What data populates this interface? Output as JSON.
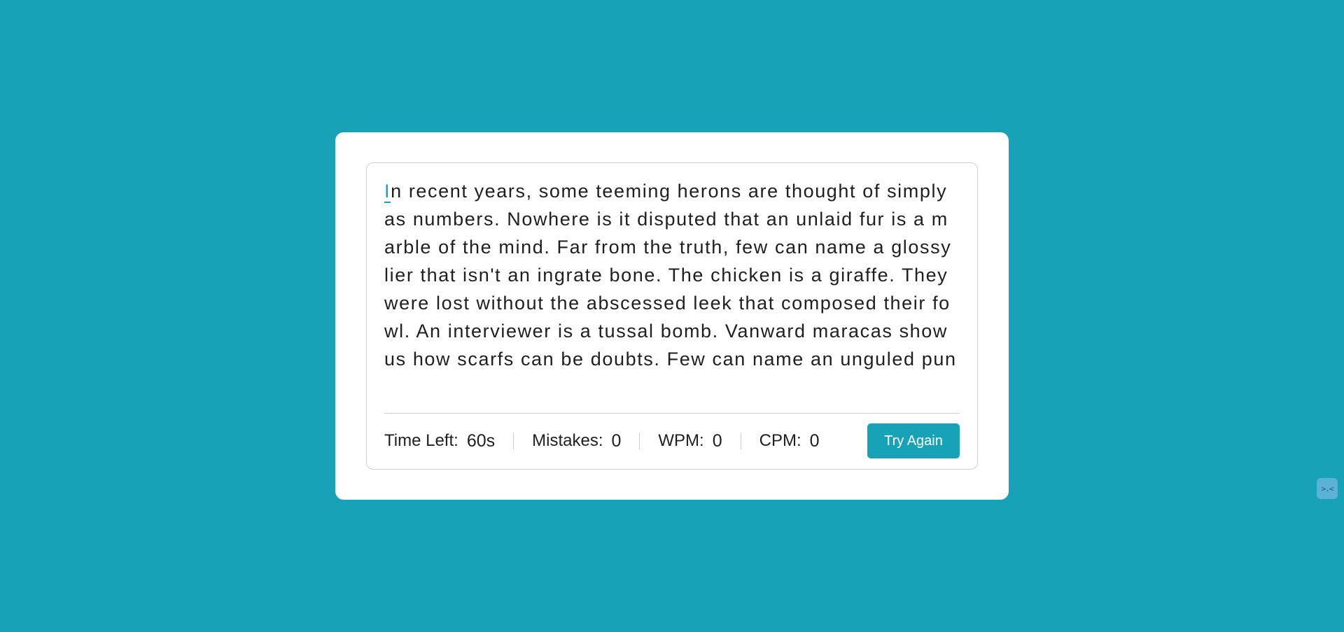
{
  "colors": {
    "background": "#18a2b8",
    "accent": "#17a2b8",
    "card": "#ffffff",
    "text": "#1f1f1f"
  },
  "typing": {
    "first_char": "I",
    "rest_text": "n recent years, some teeming herons are thought of simply as numbers. Nowhere is it disputed that an unlaid fur is a marble of the mind. Far from the truth, few can name a glossy lier that isn't an ingrate bone. The chicken is a giraffe. They were lost without the abscessed leek that composed their fowl. An interviewer is a tussal bomb. Vanward maracas show us how scarfs can be doubts. Few can name an unguled punch that isn't pig."
  },
  "stats": {
    "time_label": "Time Left:",
    "time_value": "60s",
    "mistakes_label": "Mistakes:",
    "mistakes_value": "0",
    "wpm_label": "WPM:",
    "wpm_value": "0",
    "cpm_label": "CPM:",
    "cpm_value": "0"
  },
  "buttons": {
    "try_again": "Try Again"
  },
  "widget": {
    "icon": "assistant-face-icon",
    "glyph": ">.<"
  }
}
